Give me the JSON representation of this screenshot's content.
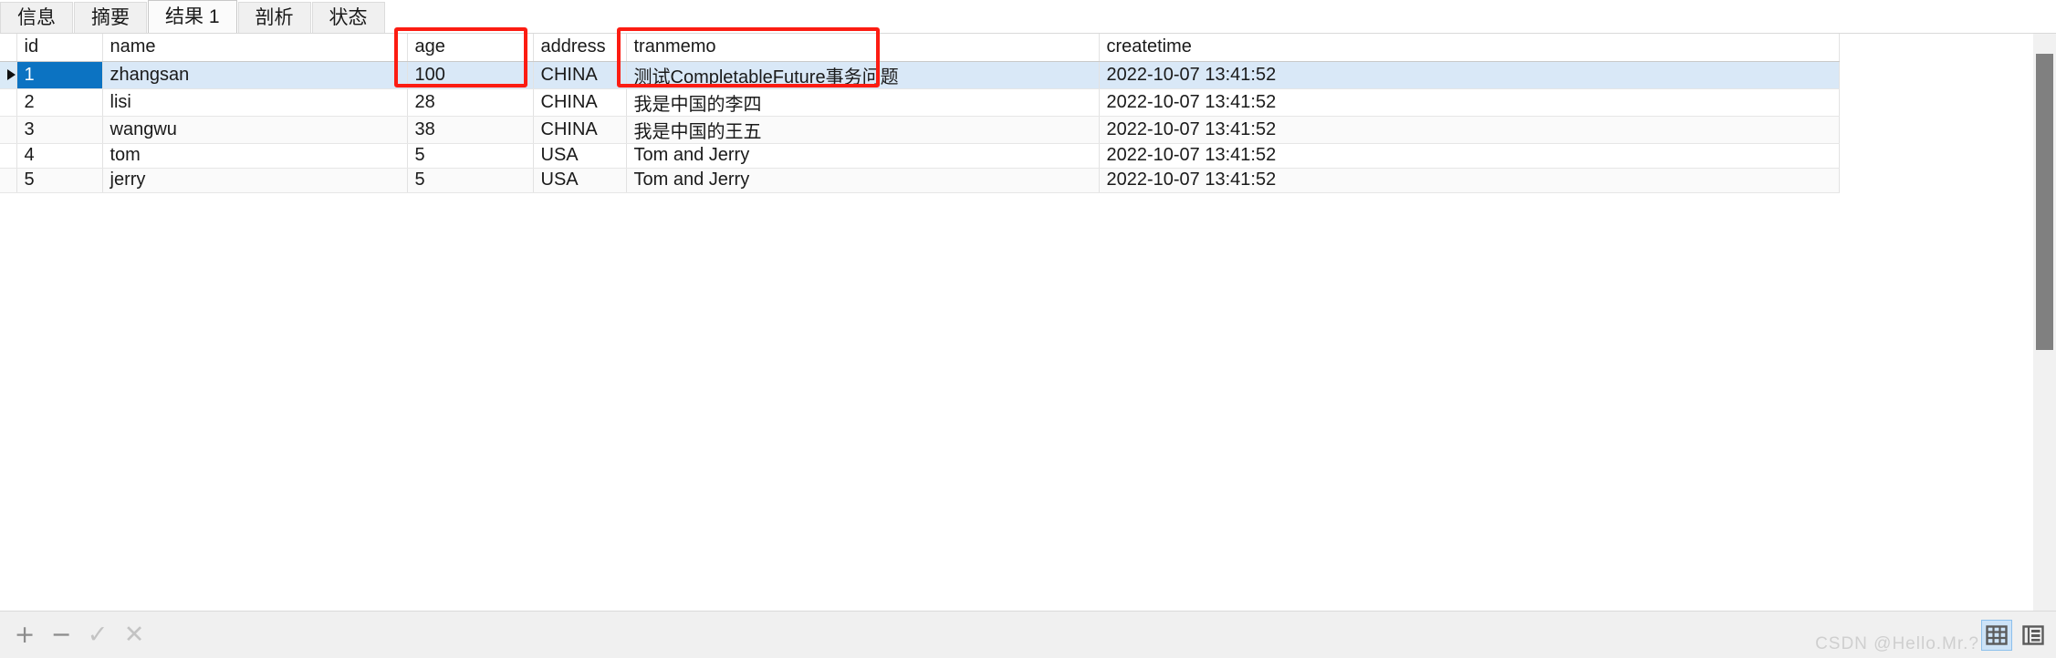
{
  "tabs": [
    {
      "label": "信息",
      "active": false
    },
    {
      "label": "摘要",
      "active": false
    },
    {
      "label": "结果 1",
      "active": true
    },
    {
      "label": "剖析",
      "active": false
    },
    {
      "label": "状态",
      "active": false
    }
  ],
  "grid": {
    "columns": [
      "id",
      "name",
      "age",
      "address",
      "tranmemo",
      "createtime"
    ],
    "rows": [
      {
        "selected": true,
        "id": "1",
        "name": "zhangsan",
        "age": "100",
        "address": "CHINA",
        "tranmemo": "测试CompletableFuture事务问题",
        "createtime": "2022-10-07 13:41:52"
      },
      {
        "selected": false,
        "id": "2",
        "name": "lisi",
        "age": "28",
        "address": "CHINA",
        "tranmemo": "我是中国的李四",
        "createtime": "2022-10-07 13:41:52"
      },
      {
        "selected": false,
        "id": "3",
        "name": "wangwu",
        "age": "38",
        "address": "CHINA",
        "tranmemo": "我是中国的王五",
        "createtime": "2022-10-07 13:41:52"
      },
      {
        "selected": false,
        "id": "4",
        "name": "tom",
        "age": "5",
        "address": "USA",
        "tranmemo": "Tom and Jerry",
        "createtime": "2022-10-07 13:41:52"
      },
      {
        "selected": false,
        "id": "5",
        "name": "jerry",
        "age": "5",
        "address": "USA",
        "tranmemo": "Tom and Jerry",
        "createtime": "2022-10-07 13:41:52"
      }
    ]
  },
  "annotations": [
    {
      "name": "age-column-highlight",
      "color": "#fc1c12"
    },
    {
      "name": "tranmemo-column-highlight",
      "color": "#fc1c12"
    }
  ],
  "bottombar": {
    "add_label": "+",
    "remove_label": "−",
    "confirm_label": "✓",
    "cancel_label": "✕"
  },
  "watermark": {
    "text": "CSDN @Hello.Mr.?"
  },
  "viewmodes": {
    "grid_label": "grid-view",
    "form_label": "form-view",
    "active": "grid-view"
  },
  "colors": {
    "selection_blue": "#0c73c2",
    "selection_row": "#d9e8f7",
    "header_selected": "#daeaf7",
    "annotation_red": "#fc1c12",
    "scrollbar_thumb": "#808080"
  }
}
